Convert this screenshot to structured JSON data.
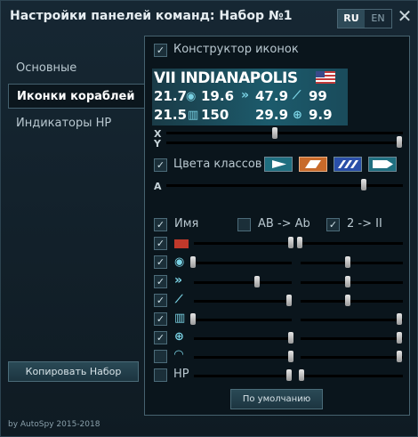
{
  "window": {
    "title": "Настройки панелей команд: Набор №1"
  },
  "lang": {
    "ru": "RU",
    "en": "EN",
    "active": "RU"
  },
  "close_label": "✕",
  "sidebar": {
    "items": [
      {
        "label": "Основные",
        "active": false
      },
      {
        "label": "Иконки кораблей",
        "active": true
      },
      {
        "label": "Индикаторы HP",
        "active": false
      }
    ],
    "copy_button": "Копировать Набор",
    "footer": "by AutoSpy 2015-2018"
  },
  "icon_constructor": {
    "label": "Конструктор иконок",
    "checked": true
  },
  "preview": {
    "ship_name": "VII INDIANAPOLIS",
    "row1": [
      "21.7",
      "19.6",
      "47.9",
      "99"
    ],
    "row2": [
      "21.5",
      "150",
      "29.9",
      "9.9"
    ]
  },
  "position": {
    "x_label": "X",
    "y_label": "Y",
    "x_value": 0.45,
    "y_value": 1.0
  },
  "class_colors": {
    "label": "Цвета классов",
    "checked": true
  },
  "alpha": {
    "label": "A",
    "value": 0.85
  },
  "options": {
    "name": {
      "label": "Имя",
      "checked": true
    },
    "ab": {
      "label": "AB -> Ab",
      "checked": false
    },
    "roman": {
      "label": "2 -> II",
      "checked": true
    }
  },
  "element_rows": [
    {
      "icon": "flag-icon",
      "checked": true
    },
    {
      "icon": "eye-icon",
      "checked": true
    },
    {
      "icon": "speed-chevrons-icon",
      "checked": true
    },
    {
      "icon": "torpedo-icon",
      "checked": true
    },
    {
      "icon": "map-icon",
      "checked": true
    },
    {
      "icon": "crosshair-icon",
      "checked": true
    },
    {
      "icon": "wifi-icon",
      "checked": false
    },
    {
      "icon": "hp-label",
      "label": "HP",
      "checked": false
    }
  ],
  "default_button": "По умолчанию",
  "colors": {
    "accent": "#1f6f80",
    "tile_active": "#c86a2a",
    "tile_blue": "#2a4fa8"
  }
}
